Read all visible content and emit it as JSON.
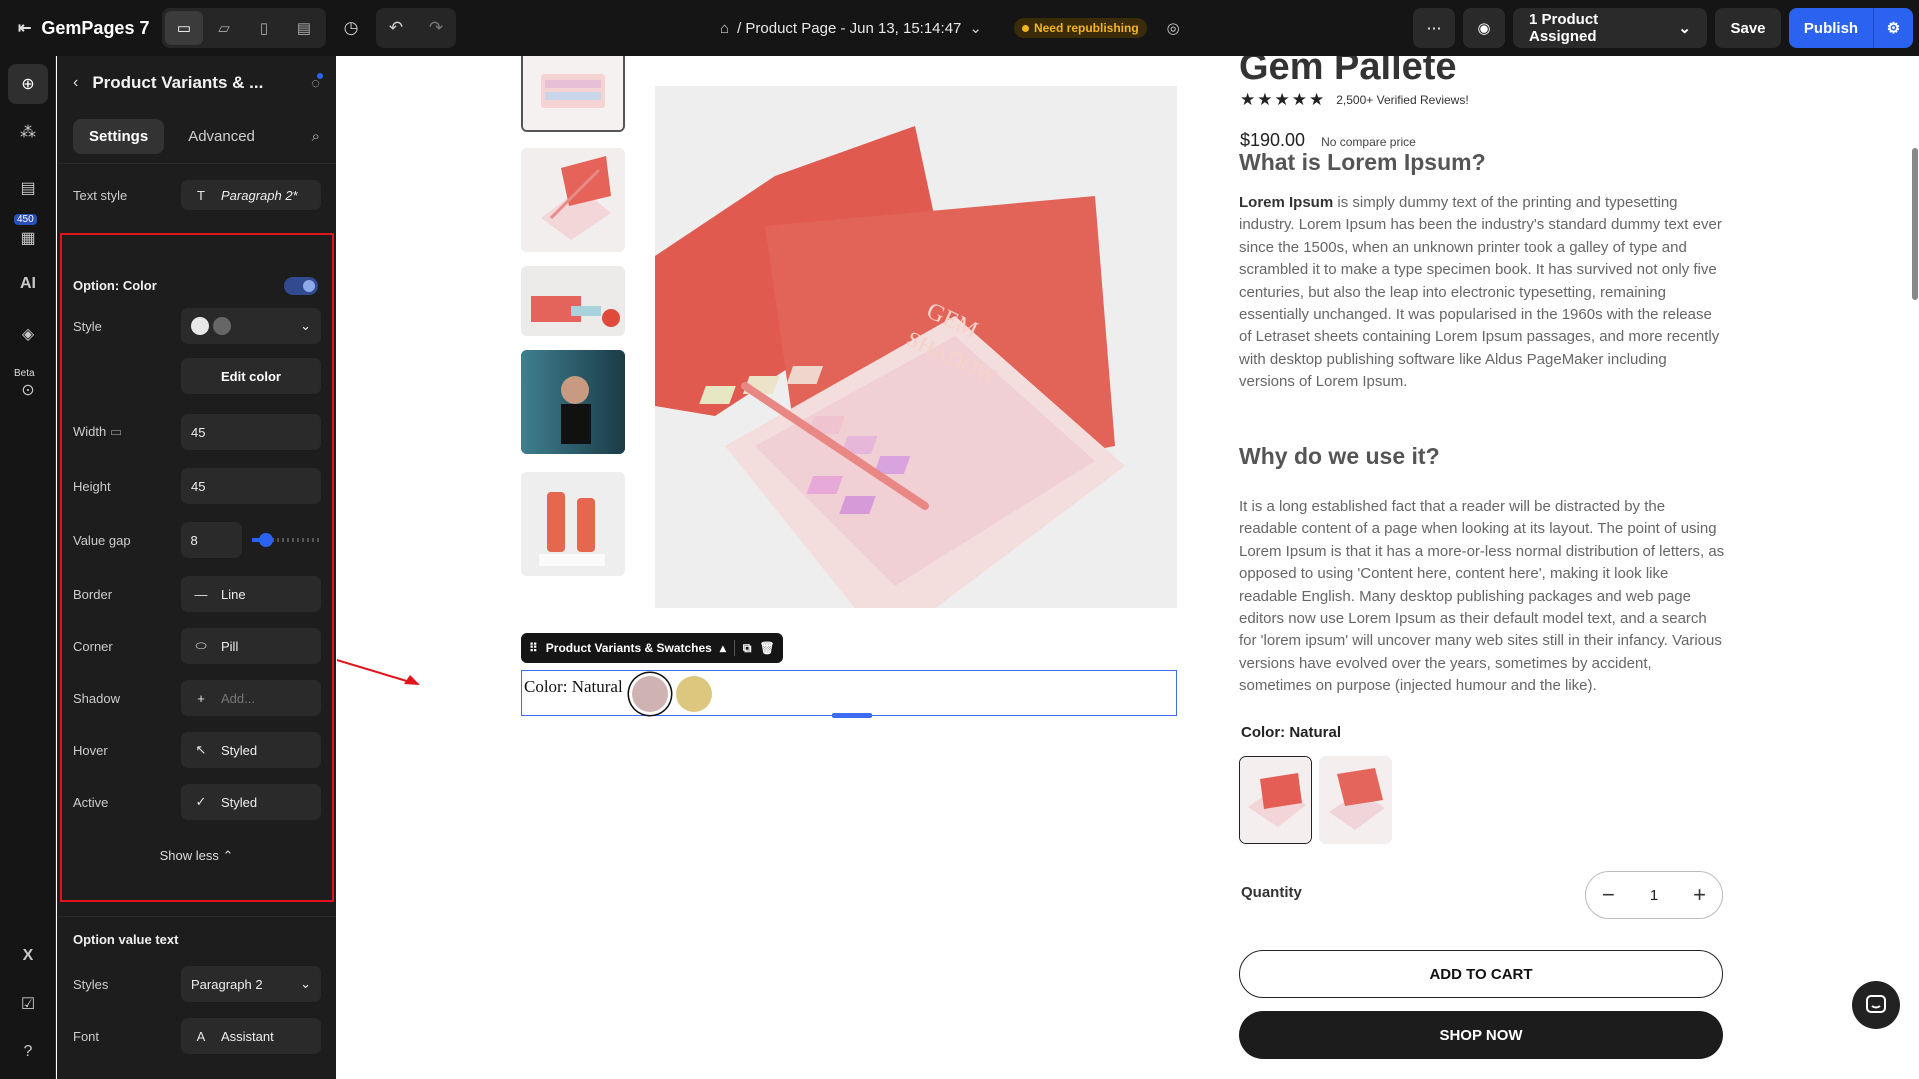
{
  "topbar": {
    "app_name": "GemPages 7",
    "page_title": "/ Product Page - Jun 13, 15:14:47",
    "status_badge": "Need republishing",
    "product_assigned": "1 Product Assigned",
    "save_label": "Save",
    "publish_label": "Publish"
  },
  "rail": {
    "template_count": "450",
    "beta_label": "Beta"
  },
  "panel": {
    "title": "Product Variants & ...",
    "tabs": [
      "Settings",
      "Advanced"
    ],
    "text_style_label": "Text style",
    "text_style_value": "Paragraph 2*",
    "option_color_label": "Option: Color",
    "option_color_enabled": true,
    "style_label": "Style",
    "edit_color_label": "Edit color",
    "width_label": "Width",
    "width_value": "45",
    "height_label": "Height",
    "height_value": "45",
    "value_gap_label": "Value gap",
    "value_gap_value": "8",
    "value_gap_slider_fraction": 0.15,
    "border_label": "Border",
    "border_value": "Line",
    "corner_label": "Corner",
    "corner_value": "Pill",
    "shadow_label": "Shadow",
    "shadow_placeholder": "Add...",
    "hover_label": "Hover",
    "hover_value": "Styled",
    "active_label": "Active",
    "active_value": "Styled",
    "show_less_label": "Show less",
    "option_value_text_label": "Option value text",
    "styles_label": "Styles",
    "styles_value": "Paragraph 2",
    "font_label": "Font",
    "font_value": "Assistant"
  },
  "canvas": {
    "variant_toolbar_label": "Product Variants & Swatches",
    "variant_label": "Color: Natural",
    "swatches": [
      {
        "name": "Natural",
        "color": "#cfb2b2",
        "selected": true
      },
      {
        "name": "Gold",
        "color": "#ddc77e",
        "selected": false
      }
    ],
    "product_title": "Gem Pallete",
    "reviews": "2,500+ Verified Reviews!",
    "rating": 5,
    "price": "$190.00",
    "compare_price": "No compare price",
    "h_what": "What is Lorem Ipsum?",
    "p1_bold": "Lorem Ipsum",
    "p1_rest": " is simply dummy text of the printing and typesetting industry. Lorem Ipsum has been the industry's standard dummy text ever since the 1500s, when an unknown printer took a galley of type and scrambled it to make a type specimen book. It has survived not only five centuries, but also the leap into electronic typesetting, remaining essentially unchanged. It was popularised in the 1960s with the release of Letraset sheets containing Lorem Ipsum passages, and more recently with desktop publishing software like Aldus PageMaker including versions of Lorem Ipsum.",
    "h_why": "Why do we use it?",
    "p2": "It is a long established fact that a reader will be distracted by the readable content of a page when looking at its layout. The point of using Lorem Ipsum is that it has a more-or-less normal distribution of letters, as opposed to using 'Content here, content here', making it look like readable English. Many desktop publishing packages and web page editors now use Lorem Ipsum as their default model text, and a search for 'lorem ipsum' will uncover many web sites still in their infancy. Various versions have evolved over the years, sometimes by accident, sometimes on purpose (injected humour and the like).",
    "option_label": "Color: Natural",
    "quantity_label": "Quantity",
    "quantity_value": "1",
    "add_to_cart": "ADD TO CART",
    "shop_now": "SHOP NOW",
    "box_text_gem": "GEM",
    "box_text_shadow": "SHADOW"
  },
  "colors": {
    "accent": "#2b63f0",
    "highlight": "#e0151c",
    "badge": "#f3b51e"
  }
}
